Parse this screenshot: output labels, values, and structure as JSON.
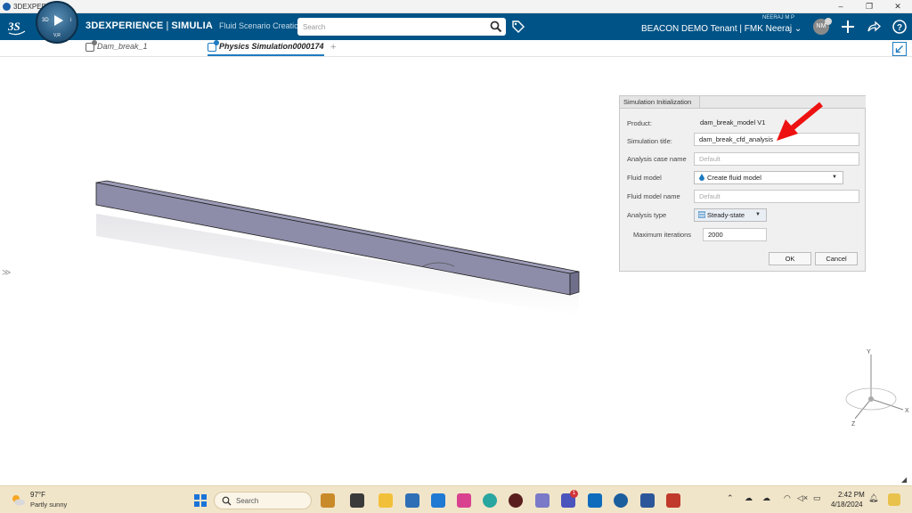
{
  "os_window": {
    "title": "3DEXPERIENCE",
    "minimize": "–",
    "maximize": "❐",
    "close": "✕"
  },
  "header": {
    "product_prefix": "3DEXPERIENCE",
    "product_brand": "SIMULIA",
    "app_name": "Fluid Scenario Creation",
    "search_placeholder": "Search",
    "user_name": "NEERAJ M P",
    "tenant_label": "BEACON DEMO Tenant | FMK Neeraj",
    "avatar_initials": "NM",
    "compass_3d": "3D",
    "compass_vr": "V,R",
    "compass_i": "i",
    "colors": {
      "bar": "#005386",
      "accent": "#1e7bc0"
    }
  },
  "tabs": [
    {
      "label": "Dam_break_1",
      "active": false
    },
    {
      "label": "Physics Simulation0000174",
      "active": true
    }
  ],
  "dialog": {
    "title": "Simulation Initialization",
    "product_label": "Product:",
    "product_value": "dam_break_model V1",
    "sim_title_label": "Simulation title:",
    "sim_title_value": "dam_break_cfd_analysis",
    "case_name_label": "Analysis case name",
    "case_name_placeholder": "Default",
    "fluid_model_label": "Fluid model",
    "fluid_model_value": "Create fluid model",
    "fluid_model_name_label": "Fluid model name",
    "fluid_model_name_placeholder": "Default",
    "analysis_type_label": "Analysis type",
    "analysis_type_value": "Steady-state",
    "max_iter_label": "Maximum iterations",
    "max_iter_value": "2000",
    "ok_label": "OK",
    "cancel_label": "Cancel"
  },
  "triad": {
    "x": "X",
    "y": "Y",
    "z": "Z"
  },
  "taskbar": {
    "weather_temp": "97°F",
    "weather_desc": "Partly sunny",
    "search_label": "Search",
    "time": "2:42 PM",
    "date": "4/18/2024",
    "notification_count": "1"
  }
}
